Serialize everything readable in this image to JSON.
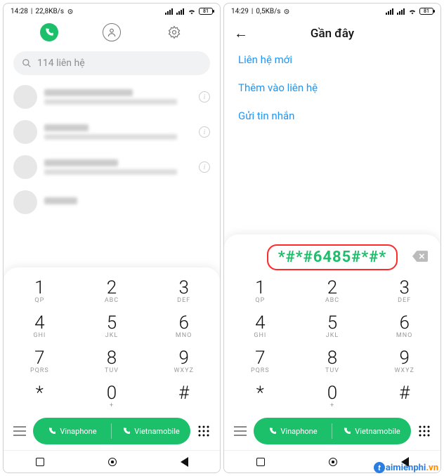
{
  "left": {
    "status": {
      "time": "14:28",
      "net": "22,8KB/s",
      "battery": "81"
    },
    "search": {
      "placeholder": "114 liên hệ"
    },
    "contacts_placeholder_rows": 4
  },
  "right": {
    "status": {
      "time": "14:29",
      "net": "0,5KB/s",
      "battery": "81"
    },
    "header": {
      "title": "Gần đây"
    },
    "actions": {
      "new_contact": "Liên hệ mới",
      "add_to_contact": "Thêm vào liên hệ",
      "send_sms": "Gửi tin nhắn"
    },
    "dial_code": "*#*#6485#*#*"
  },
  "keypad": [
    {
      "n": "1",
      "s": "QP"
    },
    {
      "n": "2",
      "s": "ABC"
    },
    {
      "n": "3",
      "s": "DEF"
    },
    {
      "n": "4",
      "s": "GHI"
    },
    {
      "n": "5",
      "s": "JKL"
    },
    {
      "n": "6",
      "s": "MNO"
    },
    {
      "n": "7",
      "s": "PQRS"
    },
    {
      "n": "8",
      "s": "TUV"
    },
    {
      "n": "9",
      "s": "WXYZ"
    },
    {
      "n": "*",
      "s": ""
    },
    {
      "n": "0",
      "s": "+"
    },
    {
      "n": "#",
      "s": ""
    }
  ],
  "call": {
    "sim1": "Vinaphone",
    "sim2": "Vietnamobile"
  },
  "watermark": {
    "brand": "aimienphi",
    "suffix": ".vn"
  }
}
